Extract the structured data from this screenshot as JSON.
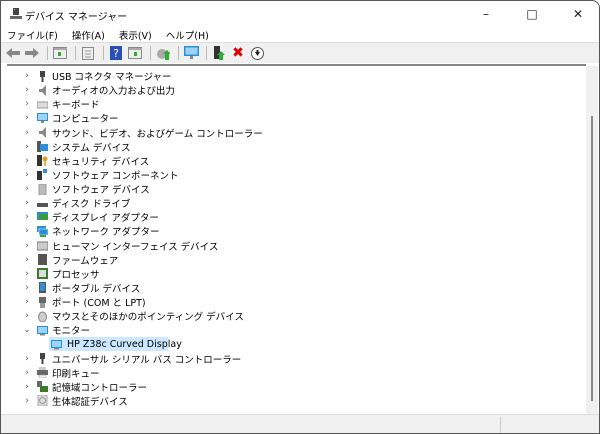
{
  "window": {
    "title": "デバイス マネージャー"
  },
  "menu": [
    "ファイル(F)",
    "操作(A)",
    "表示(V)",
    "ヘルプ(H)"
  ],
  "toolbar": [
    "back-icon",
    "forward-icon",
    "show-hide-tree-icon",
    "properties-icon",
    "help-icon",
    "action-pane-icon",
    "scan-hardware-icon",
    "monitor-icon",
    "update-driver-icon",
    "uninstall-icon",
    "disable-icon"
  ],
  "tree": [
    {
      "label": "USB コネクタ マネージャー",
      "icon": "usb",
      "color": "#444"
    },
    {
      "label": "オーディオの入力および出力",
      "icon": "speaker",
      "color": "#888"
    },
    {
      "label": "キーボード",
      "icon": "keyboard",
      "color": "#999"
    },
    {
      "label": "コンピューター",
      "icon": "computer",
      "color": "#2a8fd8"
    },
    {
      "label": "サウンド、ビデオ、およびゲーム コントローラー",
      "icon": "speaker",
      "color": "#888"
    },
    {
      "label": "システム デバイス",
      "icon": "system",
      "color": "#2a8fd8"
    },
    {
      "label": "セキュリティ デバイス",
      "icon": "security",
      "color": "#e0a020"
    },
    {
      "label": "ソフトウェア コンポーネント",
      "icon": "software-component",
      "color": "#333"
    },
    {
      "label": "ソフトウェア デバイス",
      "icon": "software-device",
      "color": "#999"
    },
    {
      "label": "ディスク ドライブ",
      "icon": "disk",
      "color": "#555"
    },
    {
      "label": "ディスプレイ アダプター",
      "icon": "display-adapter",
      "color": "#3a9a3a"
    },
    {
      "label": "ネットワーク アダプター",
      "icon": "network",
      "color": "#2a8fd8"
    },
    {
      "label": "ヒューマン インターフェイス デバイス",
      "icon": "hid",
      "color": "#777"
    },
    {
      "label": "ファームウェア",
      "icon": "firmware",
      "color": "#555"
    },
    {
      "label": "プロセッサ",
      "icon": "processor",
      "color": "#3a7a2a"
    },
    {
      "label": "ポータブル デバイス",
      "icon": "portable",
      "color": "#2a8fd8"
    },
    {
      "label": "ポート (COM と LPT)",
      "icon": "port",
      "color": "#666"
    },
    {
      "label": "マウスとそのほかのポインティング デバイス",
      "icon": "mouse",
      "color": "#888"
    },
    {
      "label": "モニター",
      "icon": "monitor",
      "color": "#2a8fd8",
      "expanded": true,
      "children": [
        {
          "label": "HP Z38c Curved Display",
          "selected": true
        }
      ]
    },
    {
      "label": "ユニバーサル シリアル バス コントローラー",
      "icon": "usb",
      "color": "#444"
    },
    {
      "label": "印刷キュー",
      "icon": "printer",
      "color": "#666"
    },
    {
      "label": "記憶域コントローラー",
      "icon": "storage",
      "color": "#3a7a2a"
    },
    {
      "label": "生体認証デバイス",
      "icon": "biometric",
      "color": "#aaa"
    }
  ]
}
